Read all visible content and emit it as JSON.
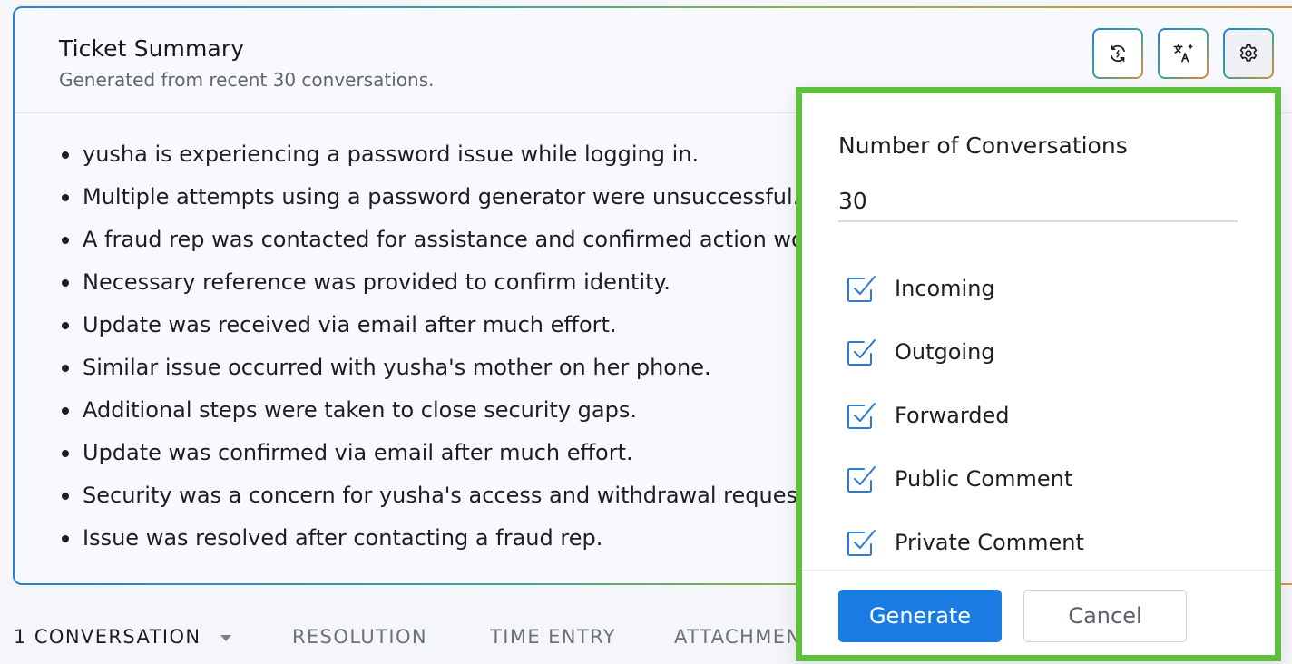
{
  "summary": {
    "title": "Ticket Summary",
    "subtitle": "Generated from recent 30 conversations.",
    "actions": [
      {
        "name": "regenerate-icon"
      },
      {
        "name": "translate-icon"
      },
      {
        "name": "gear-icon"
      }
    ],
    "items": [
      "yusha is experiencing a password issue while logging in.",
      "Multiple attempts using a password generator were unsuccessful.",
      "A fraud rep was contacted for assistance and confirmed action wo",
      "Necessary reference was provided to confirm identity.",
      "Update was received via email after much effort.",
      "Similar issue occurred with yusha's mother on her phone.",
      "Additional steps were taken to close security gaps.",
      "Update was confirmed via email after much effort.",
      "Security was a concern for yusha's access and withdrawal request",
      "Issue was resolved after contacting a fraud rep."
    ]
  },
  "tabs": [
    {
      "label": "1 CONVERSATION",
      "active": true
    },
    {
      "label": "RESOLUTION"
    },
    {
      "label": "TIME ENTRY"
    },
    {
      "label": "ATTACHMEN"
    }
  ],
  "settings_popover": {
    "label": "Number of Conversations",
    "value": "30",
    "filters": [
      {
        "label": "Incoming",
        "checked": true
      },
      {
        "label": "Outgoing",
        "checked": true
      },
      {
        "label": "Forwarded",
        "checked": true
      },
      {
        "label": "Public Comment",
        "checked": true
      },
      {
        "label": "Private Comment",
        "checked": true
      }
    ],
    "generate_label": "Generate",
    "cancel_label": "Cancel"
  },
  "colors": {
    "accent": "#1a7be2",
    "highlight": "#5ec03d",
    "checkbox": "#2a7ad6"
  }
}
